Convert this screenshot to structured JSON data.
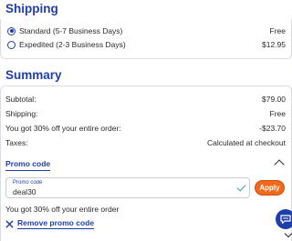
{
  "shipping": {
    "title": "Shipping",
    "options": [
      {
        "label": "Standard (5-7 Business Days)",
        "price": "Free",
        "selected": true
      },
      {
        "label": "Expedited (2-3 Business Days)",
        "price": "$12.95",
        "selected": false
      }
    ]
  },
  "summary": {
    "title": "Summary",
    "rows": [
      {
        "label": "Subtotal:",
        "value": "$79.00"
      },
      {
        "label": "Shipping:",
        "value": "Free"
      },
      {
        "label": "You got 30% off your entire order:",
        "value": "-$23.70"
      },
      {
        "label": "Taxes:",
        "value": "Calculated at checkout"
      }
    ]
  },
  "promo": {
    "link_label": "Promo code",
    "field_label": "Promo code",
    "field_value": "deal30",
    "apply_label": "Apply",
    "discount_note": "You got 30% off your entire order",
    "remove_label": "Remove promo code"
  },
  "colors": {
    "primary": "#1f3fa8",
    "accent": "#f06a1e",
    "success": "#3aa07a"
  }
}
